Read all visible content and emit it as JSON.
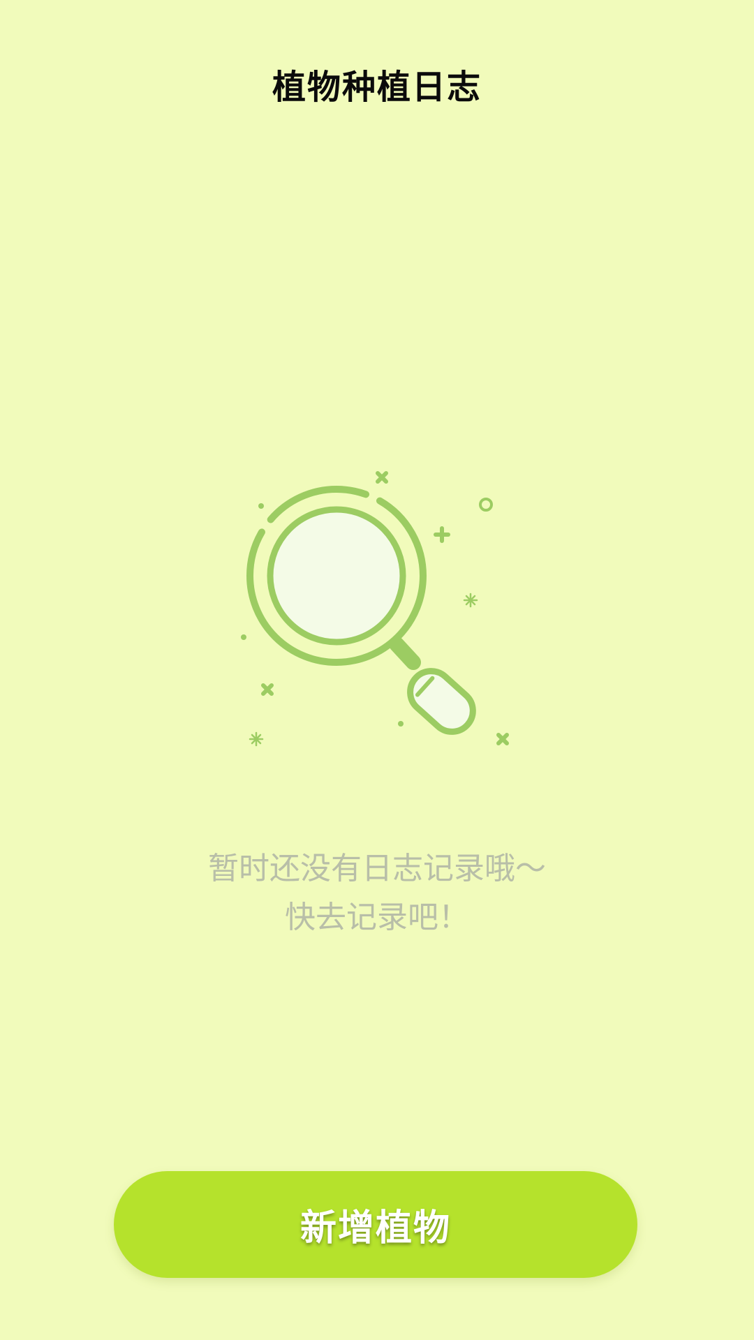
{
  "header": {
    "title": "植物种植日志"
  },
  "empty_state": {
    "icon": "magnifier-search-icon",
    "line1": "暂时还没有日志记录哦～",
    "line2": "快去记录吧！"
  },
  "actions": {
    "add_plant_label": "新增植物"
  },
  "colors": {
    "background": "#f1fbbb",
    "accent": "#b5e22c",
    "illustration": "#9ccc62",
    "muted_text": "#b8bea8",
    "title_text": "#0b0b0b"
  }
}
